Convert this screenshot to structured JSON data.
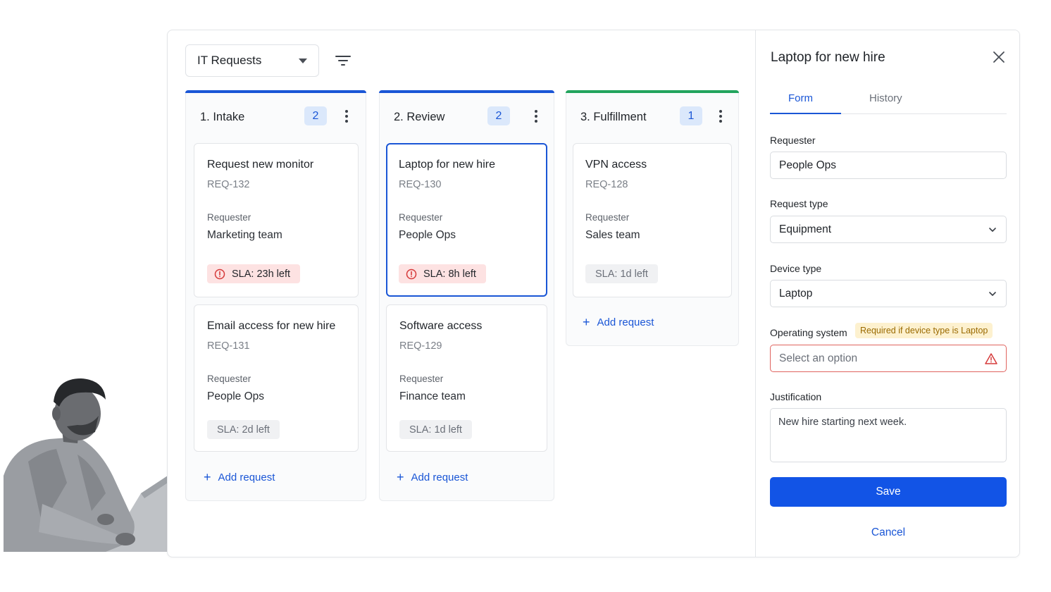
{
  "toolbar": {
    "board_name": "IT Requests"
  },
  "columns": [
    {
      "title": "1. Intake",
      "count": "2",
      "accent": "#1a56d6",
      "cards": [
        {
          "title": "Request new monitor",
          "id": "REQ-132",
          "requester_label": "Requester",
          "requester": "Marketing team",
          "sla": "SLA: 23h left",
          "sla_status": "warning"
        },
        {
          "title": "Email access for new hire",
          "id": "REQ-131",
          "requester_label": "Requester",
          "requester": "People Ops",
          "sla": "SLA: 2d left",
          "sla_status": "normal"
        }
      ],
      "add_label": "Add request"
    },
    {
      "title": "2. Review",
      "count": "2",
      "accent": "#1a56d6",
      "cards": [
        {
          "title": "Laptop for new hire",
          "id": "REQ-130",
          "requester_label": "Requester",
          "requester": "People Ops",
          "sla": "SLA: 8h left",
          "sla_status": "warning",
          "selected": true
        },
        {
          "title": "Software access",
          "id": "REQ-129",
          "requester_label": "Requester",
          "requester": "Finance team",
          "sla": "SLA: 1d left",
          "sla_status": "normal"
        }
      ],
      "add_label": "Add request"
    },
    {
      "title": "3. Fulfillment",
      "count": "1",
      "accent": "#22a45d",
      "cards": [
        {
          "title": "VPN access",
          "id": "REQ-128",
          "requester_label": "Requester",
          "requester": "Sales team",
          "sla": "SLA: 1d left",
          "sla_status": "normal"
        }
      ],
      "add_label": "Add request"
    }
  ],
  "panel": {
    "title": "Laptop for new hire",
    "tabs": [
      {
        "label": "Form",
        "active": true
      },
      {
        "label": "History",
        "active": false
      }
    ],
    "fields": {
      "requester": {
        "label": "Requester",
        "value": "People Ops"
      },
      "request_type": {
        "label": "Request type",
        "value": "Equipment"
      },
      "device_type": {
        "label": "Device type",
        "value": "Laptop"
      },
      "operating_system": {
        "label": "Operating system",
        "badge": "Required if device type is Laptop",
        "placeholder": "Select an option"
      },
      "justification": {
        "label": "Justification",
        "value": "New hire starting next week."
      }
    },
    "save_label": "Save",
    "cancel_label": "Cancel"
  },
  "colors": {
    "primary": "#1254e6",
    "error": "#e0645f",
    "warning_badge_bg": "#fdf1cf",
    "sla_warning_bg": "#fde2e2",
    "fulfillment_accent": "#22a45d"
  }
}
